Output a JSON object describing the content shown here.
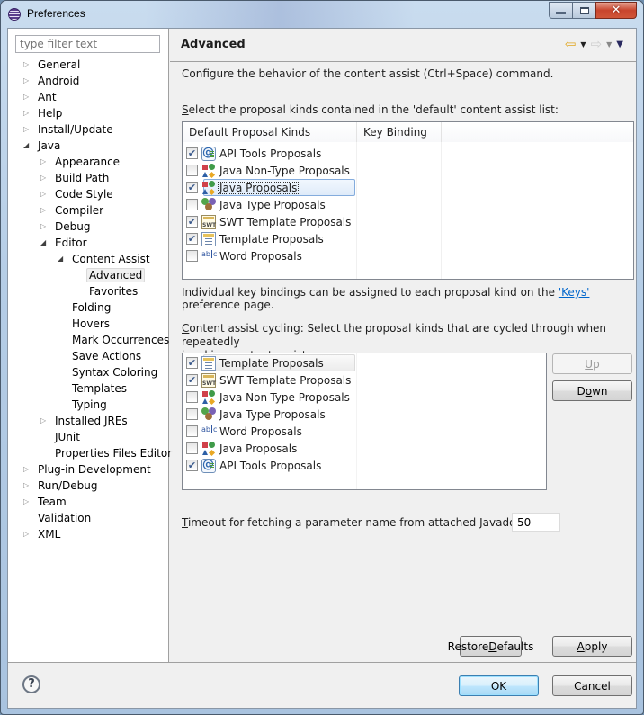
{
  "window": {
    "title": "Preferences",
    "controls": {
      "minimize": "minimize",
      "maximize": "maximize",
      "close": "✕"
    }
  },
  "filter": {
    "placeholder": "type filter text",
    "value": ""
  },
  "tree": [
    {
      "label": "General",
      "level": 0,
      "twisty": "collapsed"
    },
    {
      "label": "Android",
      "level": 0,
      "twisty": "collapsed"
    },
    {
      "label": "Ant",
      "level": 0,
      "twisty": "collapsed"
    },
    {
      "label": "Help",
      "level": 0,
      "twisty": "collapsed"
    },
    {
      "label": "Install/Update",
      "level": 0,
      "twisty": "collapsed"
    },
    {
      "label": "Java",
      "level": 0,
      "twisty": "expanded"
    },
    {
      "label": "Appearance",
      "level": 1,
      "twisty": "collapsed"
    },
    {
      "label": "Build Path",
      "level": 1,
      "twisty": "collapsed"
    },
    {
      "label": "Code Style",
      "level": 1,
      "twisty": "collapsed"
    },
    {
      "label": "Compiler",
      "level": 1,
      "twisty": "collapsed"
    },
    {
      "label": "Debug",
      "level": 1,
      "twisty": "collapsed"
    },
    {
      "label": "Editor",
      "level": 1,
      "twisty": "expanded"
    },
    {
      "label": "Content Assist",
      "level": 2,
      "twisty": "expanded"
    },
    {
      "label": "Advanced",
      "level": 3,
      "twisty": "none",
      "selected": true
    },
    {
      "label": "Favorites",
      "level": 3,
      "twisty": "none"
    },
    {
      "label": "Folding",
      "level": 2,
      "twisty": "none"
    },
    {
      "label": "Hovers",
      "level": 2,
      "twisty": "none"
    },
    {
      "label": "Mark Occurrences",
      "level": 2,
      "twisty": "none"
    },
    {
      "label": "Save Actions",
      "level": 2,
      "twisty": "none"
    },
    {
      "label": "Syntax Coloring",
      "level": 2,
      "twisty": "none"
    },
    {
      "label": "Templates",
      "level": 2,
      "twisty": "none"
    },
    {
      "label": "Typing",
      "level": 2,
      "twisty": "none"
    },
    {
      "label": "Installed JREs",
      "level": 1,
      "twisty": "collapsed"
    },
    {
      "label": "JUnit",
      "level": 1,
      "twisty": "none"
    },
    {
      "label": "Properties Files Editor",
      "level": 1,
      "twisty": "none"
    },
    {
      "label": "Plug-in Development",
      "level": 0,
      "twisty": "collapsed"
    },
    {
      "label": "Run/Debug",
      "level": 0,
      "twisty": "collapsed"
    },
    {
      "label": "Team",
      "level": 0,
      "twisty": "collapsed"
    },
    {
      "label": "Validation",
      "level": 0,
      "twisty": "none"
    },
    {
      "label": "XML",
      "level": 0,
      "twisty": "collapsed"
    }
  ],
  "page": {
    "title": "Advanced",
    "description": "Configure the behavior of the content assist (Ctrl+Space) command.",
    "default_list_label_mnemonic": "S",
    "default_list_label_rest": "elect the proposal kinds contained in the 'default' content assist list:",
    "columns": [
      "Default Proposal Kinds",
      "Key Binding"
    ],
    "default_rows": [
      {
        "label": "API Tools Proposals",
        "checked": true,
        "icon": "api-tools-icon",
        "key": ""
      },
      {
        "label": "Java Non-Type Proposals",
        "checked": false,
        "icon": "java-non-type-icon",
        "key": ""
      },
      {
        "label": "Java Proposals",
        "checked": true,
        "icon": "java-proposals-icon",
        "key": "",
        "selected": true
      },
      {
        "label": "Java Type Proposals",
        "checked": false,
        "icon": "java-type-icon",
        "key": ""
      },
      {
        "label": "SWT Template Proposals",
        "checked": true,
        "icon": "swt-template-icon",
        "key": ""
      },
      {
        "label": "Template Proposals",
        "checked": true,
        "icon": "template-icon",
        "key": ""
      },
      {
        "label": "Word Proposals",
        "checked": false,
        "icon": "word-icon",
        "key": ""
      }
    ],
    "note_prefix": "Individual key bindings can be assigned to each proposal kind on the ",
    "note_link": "'Keys'",
    "note_suffix": " preference page.",
    "cycling_label_mnemonic": "C",
    "cycling_label_line1": "ontent assist cycling: Select the proposal kinds that are cycled through when repeatedly",
    "cycling_label_line2": "invoking content assist:",
    "cycling_rows": [
      {
        "label": "Template Proposals",
        "checked": true,
        "icon": "template-icon",
        "highlighted": true
      },
      {
        "label": "SWT Template Proposals",
        "checked": true,
        "icon": "swt-template-icon"
      },
      {
        "label": "Java Non-Type Proposals",
        "checked": false,
        "icon": "java-non-type-icon"
      },
      {
        "label": "Java Type Proposals",
        "checked": false,
        "icon": "java-type-icon"
      },
      {
        "label": "Word Proposals",
        "checked": false,
        "icon": "word-icon"
      },
      {
        "label": "Java Proposals",
        "checked": false,
        "icon": "java-proposals-icon"
      },
      {
        "label": "API Tools Proposals",
        "checked": true,
        "icon": "api-tools-icon"
      }
    ],
    "up_button": {
      "mnemonic": "U",
      "rest": "p",
      "enabled": false
    },
    "down_button": {
      "pre": "D",
      "mnemonic": "o",
      "rest": "wn",
      "enabled": true
    },
    "timeout_label_mnemonic": "T",
    "timeout_label_rest": "imeout for fetching a parameter name from attached Javadoc (ms):",
    "timeout_value": "50",
    "restore_defaults": {
      "pre": "Restore ",
      "mnemonic": "D",
      "rest": "efaults"
    },
    "apply": {
      "mnemonic": "A",
      "rest": "pply"
    }
  },
  "footer": {
    "help": "?",
    "ok": "OK",
    "cancel": "Cancel"
  },
  "colors": {
    "link": "#0066cc",
    "back_arrow": "#e0a620",
    "selection_border": "#84acdd",
    "default_button_border": "#3c7fb1"
  }
}
